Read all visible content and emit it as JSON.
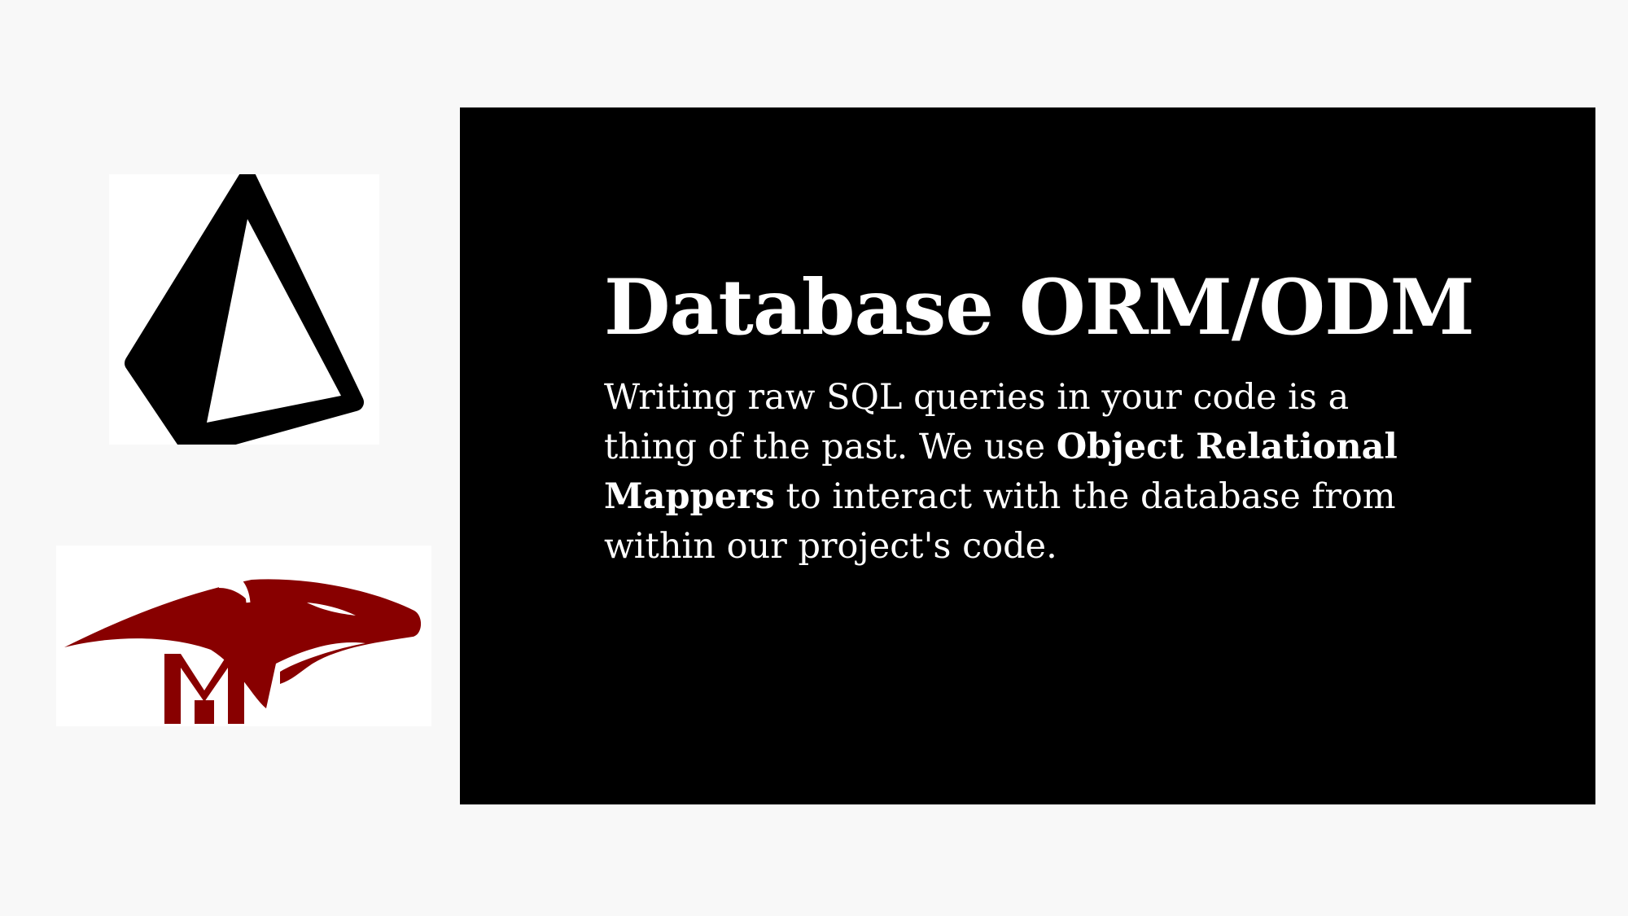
{
  "slide": {
    "title": "Database ORM/ODM",
    "body": {
      "before_bold": "Writing raw SQL queries in your code is a thing of the past. We use ",
      "bold": "Object Relational Mappers",
      "after_bold": " to interact with the database from within our project's code."
    }
  },
  "logos": {
    "top": {
      "icon": "prisma-logo-icon"
    },
    "bottom": {
      "icon": "mongoose-logo-icon",
      "letter": "M"
    }
  },
  "colors": {
    "background": "#f8f8f8",
    "panel": "#000000",
    "text": "#ffffff",
    "mongoose_red": "#880000"
  }
}
